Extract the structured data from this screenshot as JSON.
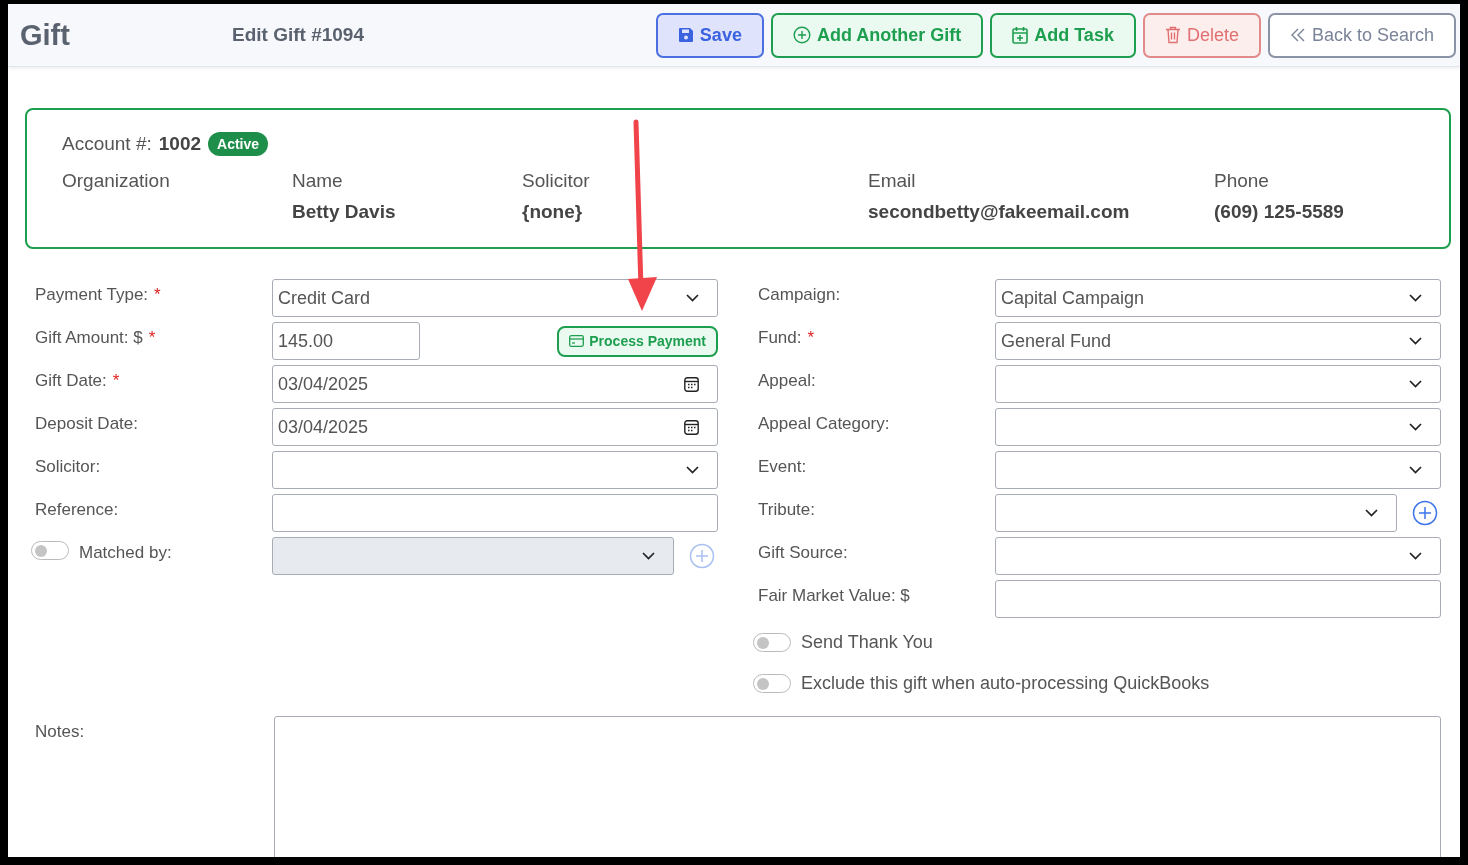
{
  "header": {
    "title": "Gift",
    "subtitle": "Edit Gift #1094",
    "buttons": [
      {
        "kind": "save",
        "label": "Save"
      },
      {
        "kind": "add",
        "label": "Add Another Gift"
      },
      {
        "kind": "task",
        "label": "Add Task"
      },
      {
        "kind": "delete",
        "label": "Delete"
      },
      {
        "kind": "back",
        "label": "Back to Search"
      }
    ]
  },
  "account": {
    "label": "Account #:",
    "number": "1002",
    "status": "Active",
    "columns": [
      {
        "label": "Organization"
      },
      {
        "label": "Name",
        "value": "Betty Davis"
      },
      {
        "label": "Solicitor",
        "value": "{none}"
      },
      {
        "label": "Email",
        "value": "secondbetty@fakeemail.com"
      },
      {
        "label": "Phone",
        "value": "(609) 125-5589"
      }
    ]
  },
  "left_fields": [
    {
      "kind": "select",
      "label": "Payment Type:",
      "required_mark": "*",
      "value": "Credit Card"
    },
    {
      "kind": "amount",
      "label": "Gift Amount: $",
      "required_mark": "*",
      "value": "145.00",
      "button": "Process Payment"
    },
    {
      "kind": "date",
      "label": "Gift Date:",
      "required_mark": "*",
      "value": "03/04/2025"
    },
    {
      "kind": "date",
      "label": "Deposit Date:",
      "value": "03/04/2025"
    },
    {
      "kind": "select",
      "label": "Solicitor:"
    },
    {
      "kind": "text",
      "label": "Reference:"
    },
    {
      "kind": "toggle-select",
      "label": "Matched by:",
      "on": false,
      "disabled": true,
      "add_button": true
    }
  ],
  "right_fields": [
    {
      "kind": "select",
      "label": "Campaign:",
      "value": "Capital Campaign"
    },
    {
      "kind": "select",
      "label": "Fund:",
      "required_mark": "*",
      "value": "General Fund"
    },
    {
      "kind": "select",
      "label": "Appeal:"
    },
    {
      "kind": "select",
      "label": "Appeal Category:"
    },
    {
      "kind": "select",
      "label": "Event:"
    },
    {
      "kind": "select",
      "label": "Tribute:",
      "add_button": true
    },
    {
      "kind": "select",
      "label": "Gift Source:"
    },
    {
      "kind": "text",
      "label": "Fair Market Value: $"
    }
  ],
  "toggles": [
    {
      "label": "Send Thank You",
      "on": false
    },
    {
      "label": "Exclude this gift when auto-processing QuickBooks",
      "on": false
    }
  ],
  "notes": {
    "label": "Notes:"
  }
}
